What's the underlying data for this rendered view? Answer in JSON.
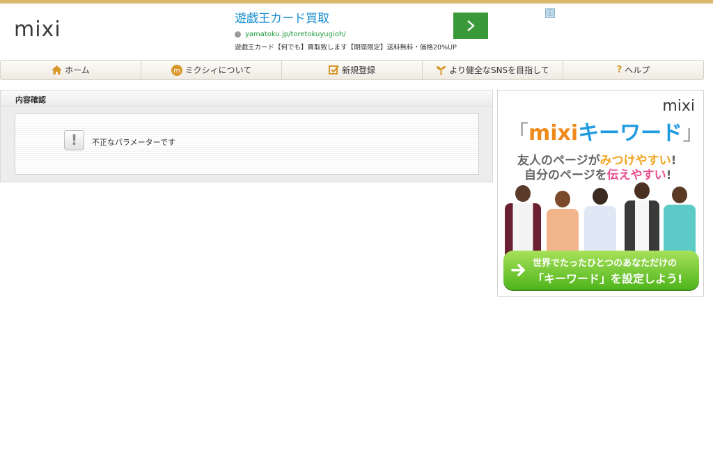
{
  "header": {
    "logo_text": "mixi"
  },
  "ad_top": {
    "title": "遊戯王カード買取",
    "url": "yamatoku.jp/toretokuyugioh/",
    "description": "遊戯王カード【何でも】買取致します【期間限定】送料無料・価格20%UP",
    "info_icon_glyph": "ⓘ"
  },
  "nav": {
    "items": [
      {
        "label": "ホーム",
        "icon": "home-icon"
      },
      {
        "label": "ミクシィについて",
        "icon": "mixi-m-icon"
      },
      {
        "label": "新規登録",
        "icon": "checkbox-icon"
      },
      {
        "label": "より健全なSNSを目指して",
        "icon": "sprout-icon"
      },
      {
        "label": "ヘルプ",
        "icon": "question-icon"
      }
    ]
  },
  "panel": {
    "title": "内容確認",
    "message": "不正なパラメーターです",
    "warn_glyph": "!"
  },
  "banner": {
    "brand": "mixi",
    "title_open": "「",
    "title_mixi": "mixi",
    "title_keyword": "キーワード",
    "title_close": "」",
    "line1_pre": "友人のページが",
    "line1_hl": "みつけやすい",
    "line1_post": "!",
    "line2_pre": "自分のページを",
    "line2_hl": "伝えやすい",
    "line2_post": "!",
    "cta_line1": "世界でたったひとつのあなただけの",
    "cta_line2": "「キーワード」を設定しよう!"
  },
  "colors": {
    "top_bar": "#d8b969",
    "ad_title": "#1a8ed1",
    "ad_url": "#1c9b3a",
    "ad_button": "#3a9a3a",
    "nav_icon": "#d8972a",
    "banner_orange": "#ef8a1c",
    "banner_blue": "#1e9be0",
    "cta_green": "#4fb51c"
  }
}
